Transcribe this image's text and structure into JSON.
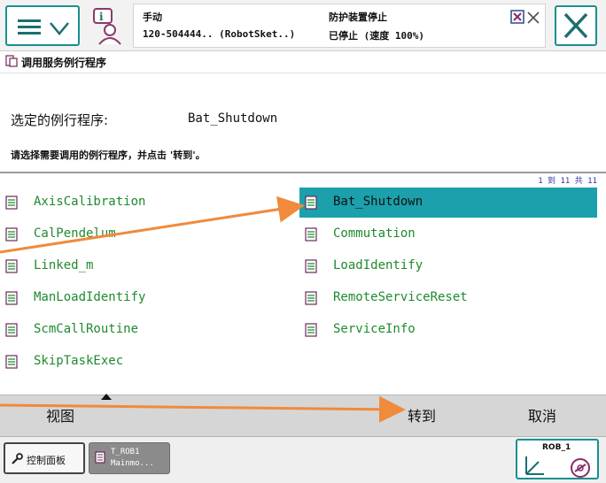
{
  "topbar": {
    "status_line1_left": "手动",
    "status_line2_left": "120-504444.. (RobotSket..)",
    "status_line1_right": "防护装置停止",
    "status_line2_right": "已停止 (速度 100%)"
  },
  "breadcrumb": {
    "text": "调用服务例行程序"
  },
  "info": {
    "selected_label": "选定的例行程序:",
    "selected_value": "Bat_Shutdown",
    "instruction": "请选择需要调用的例行程序，并点击 '转到'。"
  },
  "list": {
    "page_info": "1 到 11 共 11",
    "routines": [
      {
        "label": "AxisCalibration"
      },
      {
        "label": "Bat_Shutdown",
        "selected": true
      },
      {
        "label": "CalPendelum"
      },
      {
        "label": "Commutation"
      },
      {
        "label": "Linked_m"
      },
      {
        "label": "LoadIdentify"
      },
      {
        "label": "ManLoadIdentify"
      },
      {
        "label": "RemoteServiceReset"
      },
      {
        "label": "ScmCallRoutine"
      },
      {
        "label": "ServiceInfo"
      },
      {
        "label": "SkipTaskExec"
      }
    ]
  },
  "bottombar": {
    "view": "视图",
    "goto": "转到",
    "cancel": "取消"
  },
  "taskbar": {
    "control_panel": "控制面板",
    "task_line1": "T_ROB1",
    "task_line2": "Mainmo...",
    "robot": "ROB_1"
  },
  "colors": {
    "accent": "#1b8f8f",
    "selected_row": "#1ba0ac",
    "routine_text": "#1e8a2e",
    "annotation_arrow": "#f08a3c"
  }
}
